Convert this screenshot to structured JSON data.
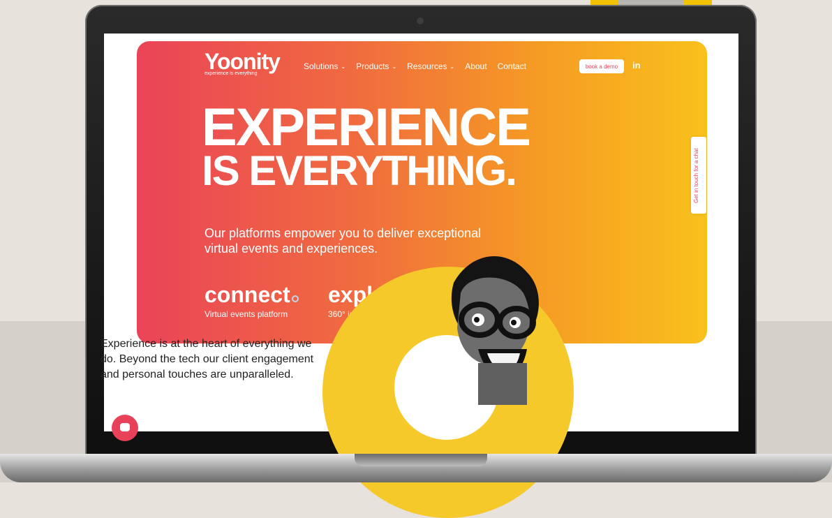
{
  "nav": {
    "logo": "Yoonity",
    "tagline": "experience is everything",
    "items": [
      {
        "label": "Solutions",
        "has_dropdown": true
      },
      {
        "label": "Products",
        "has_dropdown": true
      },
      {
        "label": "Resources",
        "has_dropdown": true
      },
      {
        "label": "About",
        "has_dropdown": false
      },
      {
        "label": "Contact",
        "has_dropdown": false
      }
    ],
    "cta": "book a demo",
    "social": "in"
  },
  "hero": {
    "headline_1": "EXPERIENCE",
    "headline_2": "IS EVERYTHING.",
    "subtext": "Our platforms empower you to deliver exceptional virtual events and experiences.",
    "products": [
      {
        "name": "connect",
        "desc": "Virtual events platform"
      },
      {
        "name": "explore",
        "desc": "360° interactive experiences"
      }
    ]
  },
  "side_tab": "Get in touch for a chat",
  "about": {
    "text": "Experience is at the heart of everything we do. Beyond the tech our client engagement and personal touches are unparalleled."
  },
  "colors": {
    "gradient_start": "#ea4358",
    "gradient_end": "#f9c11c",
    "accent": "#e8425a",
    "ring": "#f6c92b"
  },
  "icons": [
    "chevron-down-icon",
    "linkedin-icon",
    "chat-icon",
    "camera-icon"
  ]
}
